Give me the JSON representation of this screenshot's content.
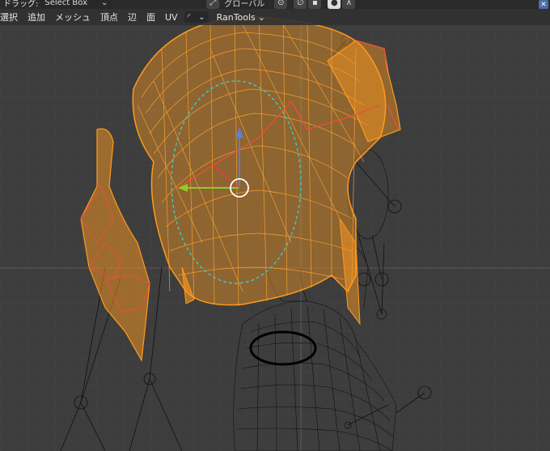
{
  "topbar": {
    "drag_label": "ドラッグ:",
    "select_mode": "Select Box",
    "orientation": "グローバル",
    "close_icon": "close-icon"
  },
  "menubar": {
    "items": [
      "選択",
      "追加",
      "メッシュ",
      "頂点",
      "辺",
      "面",
      "UV"
    ],
    "addon_menu": "RanTools"
  },
  "colors": {
    "viewport_bg": "#3d3d3d",
    "selected_wire": "#ff9a1f",
    "selected_edge": "#e8503a",
    "unselected_wire": "#111111",
    "axis_x": "#e04040",
    "axis_y": "#8ccf22",
    "axis_z": "#5b7fd6",
    "uv_circle": "#3fc9c9"
  }
}
